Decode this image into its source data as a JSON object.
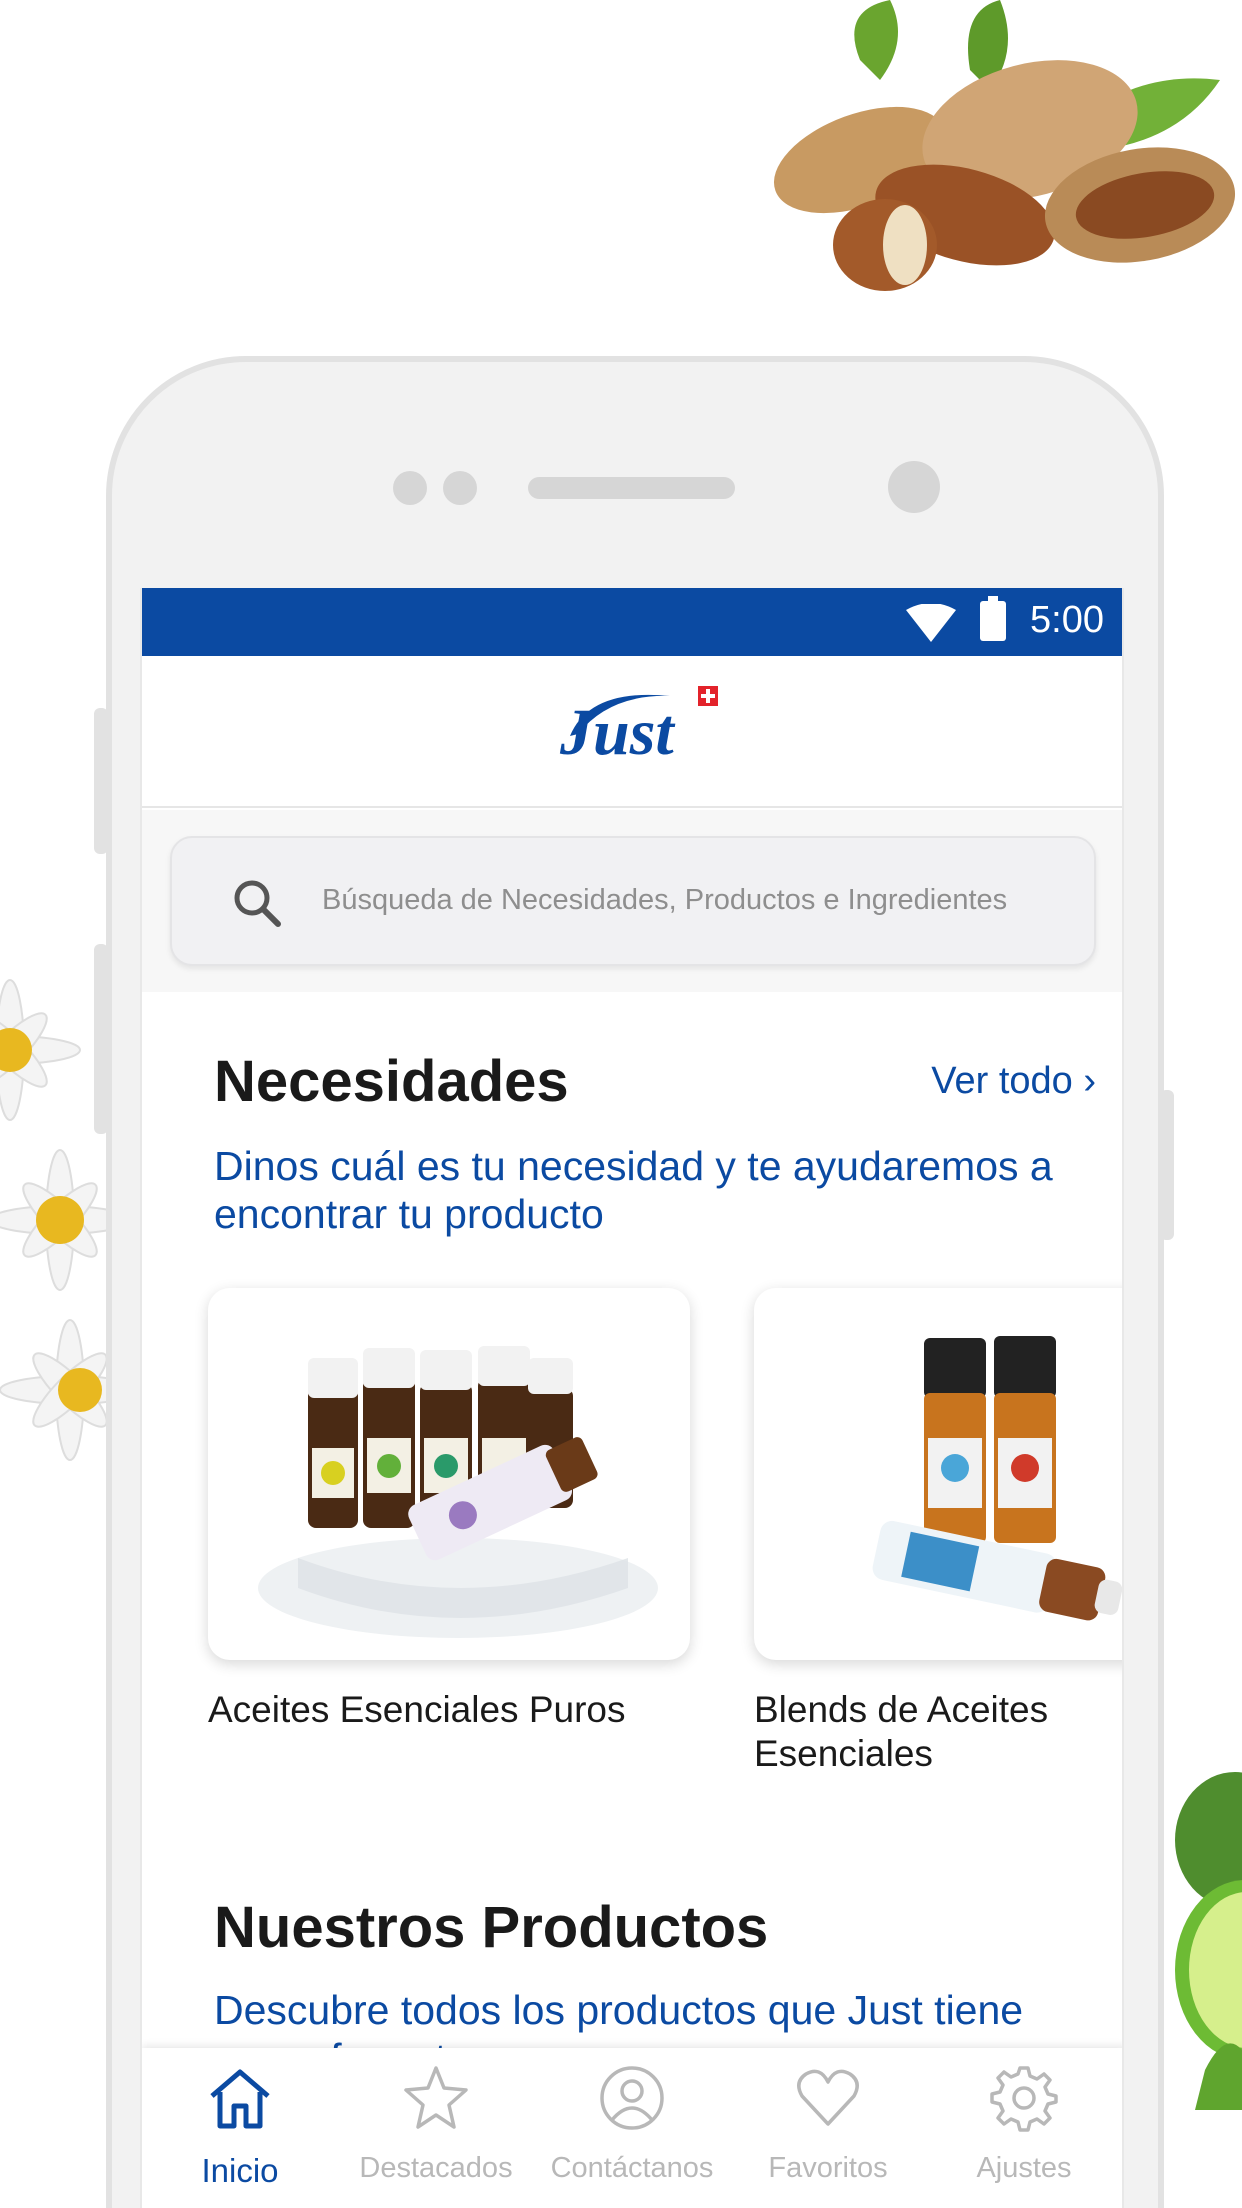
{
  "status_bar": {
    "time": "5:00"
  },
  "header": {
    "logo_text": "Just"
  },
  "search": {
    "placeholder": "Búsqueda de Necesidades, Productos e Ingredientes"
  },
  "necesidades": {
    "title": "Necesidades",
    "see_all": "Ver todo ›",
    "subtitle_line1": "Dinos cuál es tu necesidad y te ayudaremos a",
    "subtitle_line2": "encontrar tu producto",
    "cards": [
      {
        "label_line1": "Aceites Esenciales Puros",
        "label_line2": ""
      },
      {
        "label_line1": "Blends de Aceites",
        "label_line2": "Esenciales"
      }
    ]
  },
  "productos": {
    "title": "Nuestros Productos",
    "subtitle_line1": "Descubre todos los productos que Just tiene",
    "subtitle_line2": "para ofrecerte"
  },
  "bottom_nav": {
    "items": [
      {
        "label": "Inicio",
        "icon": "home-icon",
        "active": true
      },
      {
        "label": "Destacados",
        "icon": "star-icon",
        "active": false
      },
      {
        "label": "Contáctanos",
        "icon": "contact-icon",
        "active": false
      },
      {
        "label": "Favoritos",
        "icon": "heart-icon",
        "active": false
      },
      {
        "label": "Ajustes",
        "icon": "gear-icon",
        "active": false
      }
    ]
  },
  "colors": {
    "brand_blue": "#0b4aa2",
    "inactive_gray": "#b8b8b8",
    "logo_red": "#e3232b"
  }
}
